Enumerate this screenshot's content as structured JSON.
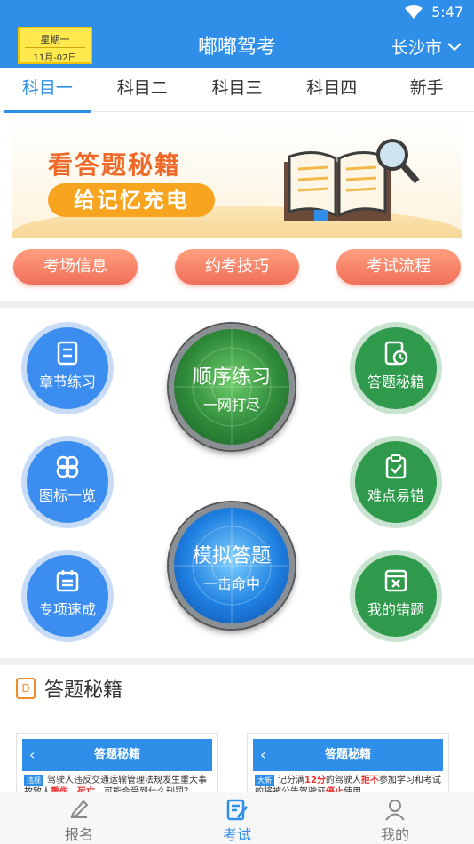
{
  "status": {
    "time": "5:47"
  },
  "header": {
    "weekday": "星期一",
    "date": "11月-02日",
    "title": "嘟嘟驾考",
    "city": "长沙市"
  },
  "tabs": [
    {
      "label": "科目一",
      "active": true
    },
    {
      "label": "科目二",
      "active": false
    },
    {
      "label": "科目三",
      "active": false
    },
    {
      "label": "科目四",
      "active": false
    },
    {
      "label": "新手",
      "active": false
    }
  ],
  "banner": {
    "title": "看答题秘籍",
    "subtitle": "给记忆充电"
  },
  "pills": [
    "考场信息",
    "约考技巧",
    "考试流程"
  ],
  "circles": {
    "chapter": "章节练习",
    "icons": "图标一览",
    "special": "专项速成",
    "tips": "答题秘籍",
    "hard": "难点易错",
    "mistakes": "我的错题"
  },
  "big_buttons": {
    "order": {
      "title": "顺序练习",
      "sub": "一网打尽"
    },
    "mock": {
      "title": "模拟答题",
      "sub": "一击命中"
    }
  },
  "section": {
    "icon_letter": "D",
    "title": "答题秘籍"
  },
  "cards": [
    {
      "header": "答题秘籍",
      "tag": "违规",
      "text_a": "驾驶人违反交通运输管理法规发生重大事故",
      "text_b": "致人",
      "red_a": "重伤、死亡",
      "text_c": "，可能会受到什么刑罚？"
    },
    {
      "header": "答题秘籍",
      "tag": "大新",
      "text_a": "记分满",
      "red_a": "12分",
      "text_b": "的驾驶人",
      "red_b": "拒不",
      "text_c": "参加学习和考试的",
      "text_d": "将被公告驾驶证",
      "red_c": "停止",
      "text_e": "使用"
    }
  ],
  "bottom_nav": [
    {
      "label": "报名",
      "active": false
    },
    {
      "label": "考试",
      "active": true
    },
    {
      "label": "我的",
      "active": false
    }
  ],
  "colors": {
    "primary": "#2f8fe8",
    "green": "#2f9a4c",
    "orange": "#f28a2e",
    "pill": "#f0705a"
  }
}
